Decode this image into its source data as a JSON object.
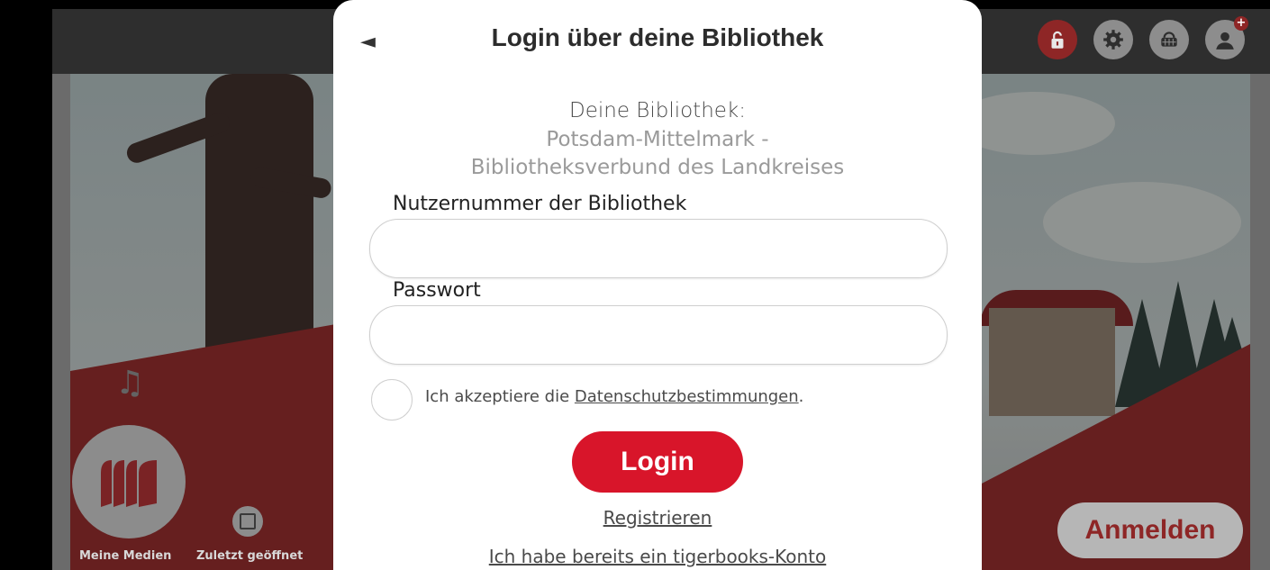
{
  "modal": {
    "back_glyph": "◄",
    "title": "Login über deine Bibliothek",
    "library_heading": "Deine Bibliothek:",
    "library_name_line1": "Potsdam-Mittelmark -",
    "library_name_line2": "Bibliotheksverbund des Landkreises",
    "user_number_label": "Nutzernummer der Bibliothek",
    "user_number_value": "",
    "password_label": "Passwort",
    "password_value": "",
    "privacy_prefix": "Ich akzeptiere die ",
    "privacy_link": "Datenschutzbestimmungen",
    "privacy_suffix": ".",
    "login_label": "Login",
    "register_label": "Registrieren",
    "have_account_label": "Ich habe bereits ein tigerbooks-Konto"
  },
  "background": {
    "my_media_label": "Meine Medien",
    "recent_label": "Zuletzt geöffnet",
    "sign_in_label": "Anmelden"
  },
  "topbar": {
    "icons": [
      "lock-icon",
      "gear-icon",
      "basket-icon",
      "avatar-icon"
    ],
    "avatar_badge": "+"
  },
  "colors": {
    "accent": "#d8152a",
    "modal_bg": "#ffffff",
    "overlay_red": "#8e2626"
  }
}
